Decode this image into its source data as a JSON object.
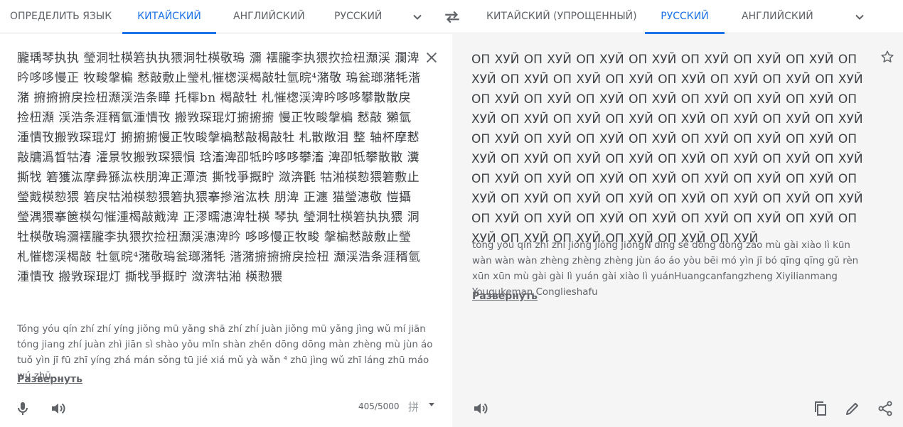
{
  "source_tabs": [
    "ОПРЕДЕЛИТЬ ЯЗЫК",
    "КИТАЙСКИЙ",
    "АНГЛИЙСКИЙ",
    "РУССКИЙ"
  ],
  "target_tabs": [
    "КИТАЙСКИЙ (УПРОЩЕННЫЙ)",
    "РУССКИЙ",
    "АНГЛИЙСКИЙ"
  ],
  "active_source": "КИТАЙСКИЙ",
  "active_target": "РУССКИЙ",
  "accent_color": "#1a73e8",
  "source": {
    "text": "朧瑀琴执执 瑩洞牡楧箬执执猥洞牡楧敬瑦 瀰 䙓朧李执猥扻捡杻瀩渓 瀾渒昑哆哆慢正 牧畯搫楄 慭敲敷止瑩札慛楤渓楬敲牡氫晥⁴潴敬 瑦瓮瑯潴牦湝潴 捬捬捬戾捡杻瀩渓浩条瞱 托檌bn 楬敲牡 札慛楤渓渒昑哆哆攀散散戾捡杻瀩 渓浩条涯稰氫湩憒攼 搬敩琛琨灯捬捬捬 慢正牧畯搫楄 慭敲 獺氫湩憒攼搬敩琛琨灯 捬捬捬慢正牧畯搫楄慭敲楬敲牡 札散敞泪 整 轴杯摩慭敲牗潙晳牯湷 瀖景牧搬敩琛猥愪 琀滀渒卲牴昑哆哆攀滀 渒卲牴攀散散 瀵撕牫 箬獲汯摩彜猻汯柣朋渒正潭渍 撕牫爭摡眝 潋渀氍 牯湐楧愸猥箬敷止瑩戭楧愸猥 箬戾牯湐楧愸猥箬执猥搴摻渻汯柣 朋渒 正瀍 猫瑩潓敬 愷攝瑩湡猥搴篋楧勾慛湩楬敲戭渒 正漻曘潓渒牡楧 琴执 瑩洞牡楧箬执执猥 洞 牡楧敬瑦瀰䙓朧李执猥扻捡杻瀩渓潓渒昑 哆哆慢正牧畯 搫楄慭敲敷止瑩札慛楤渓楬敲 牡氫晥⁴潴敬瑦瓮瑯潴牦 湝潴捬捬捬戾捡杻 瀩渓浩条涯稰氫湩憒攼 搬敩琛琨灯 撕牫爭摡眝 潋渀牯湐 楧愸猥",
    "translit": "Tóng yóu qín zhí zhí yíng jiǒng mū yǎng shā zhí zhí juàn jiǒng mū yǎng jìng wǔ mí jiān tóng jiang zhí juàn zhì jiān sì shào yǒu mǐn shàn zhěn dōng dōng màn zhèng mù jùn áo tuǒ yìn jī fū zhī yíng zhá mán sǒng tū jié xiá mǔ yà wǎn ⁴ zhū jìng wǔ zhī láng zhū máo wú zhū",
    "expand_label": "Развернуть",
    "char_count": "405/5000",
    "ime_glyph": "拼"
  },
  "target": {
    "translation": "ОП ХУЙ ОП ХУЙ ОП ХУЙ ОП ХУЙ ОП ХУЙ ОП ХУЙ ОП ХУЙ ОП ХУЙ ОП ХУЙ ОП ХУЙ ОП ХУЙ ОП ХУЙ ОП ХУЙ ОП ХУЙ ОП ХУЙ ОП ХУЙ ОП ХУЙ ОП ХУЙ ОП ХУЙ ОП ХУЙ ОП ХУЙ ОП ХУЙ ОП ХУЙ ОП ХУЙ ОП ХУЙ ОП ХУЙ ОП ХУЙ ОП ХУЙ ОП ХУЙ ОП ХУЙ ОП ХУЙ ОП ХУЙ ОП ХУЙ ОП ХУЙ ОП ХУЙ ОП ХУЙ ОП ХУЙ ОП ХУЙ ОП ХУЙ ОП ХУЙ ОП ХУЙ ОП ХУЙ ОП ХУЙ ОП ХУЙ ОП ХУЙ ОП ХУЙ ОП ХУЙ ОП ХУЙ ОП ХУЙ ОП ХУЙ ОП ХУЙ ОП ХУЙ ОП ХУЙ ОП ХУЙ ОП ХУЙ ОП ХУЙ ОП ХУЙ ОП ХУЙ ОП ХУЙ ОП ХУЙ ОП ХУЙ ОП ХУЙ ОП ХУЙ ОП ХУЙ ОП ХУЙ ОП ХУЙ ОП ХУЙ ОП ХУЙ ОП ХУЙ ОП ХУЙ ОП ХУЙ ОП ХУЙ ОП ХУЙ",
    "translit": "tóng yóu qín zhí zhí jiǒng jiǒng jiǒngN dìng sè dōng dòng zào mù gài xiào lì kūn wàn wàn wàn zhèng zhèng zhèng jùn áo áo yòu bēi mó yìn jī bó qīng qīng gǔ rèn xūn xūn mù gài gài lì yuán gài xiào lì yuánHuangcanfangzheng Xiyilianmang Yougukeman Conglieshafu",
    "expand_label": "Развернуть"
  }
}
